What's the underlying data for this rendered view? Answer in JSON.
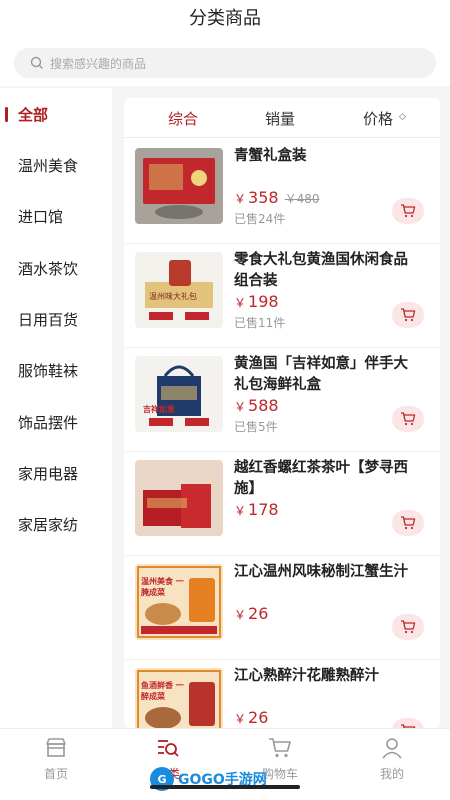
{
  "header": {
    "title": "分类商品"
  },
  "search": {
    "placeholder": "搜索感兴趣的商品"
  },
  "sidebar": {
    "items": [
      {
        "label": "全部",
        "active": true
      },
      {
        "label": "温州美食"
      },
      {
        "label": "进口馆"
      },
      {
        "label": "酒水茶饮"
      },
      {
        "label": "日用百货"
      },
      {
        "label": "服饰鞋袜"
      },
      {
        "label": "饰品摆件"
      },
      {
        "label": "家用电器"
      },
      {
        "label": "家居家纺"
      }
    ]
  },
  "sort": {
    "items": [
      {
        "label": "综合",
        "active": true
      },
      {
        "label": "销量"
      },
      {
        "label": "价格"
      }
    ]
  },
  "currency": "￥",
  "products": [
    {
      "name": "青蟹礼盒装",
      "price": "358",
      "original_price": "￥480",
      "sold": "已售24件"
    },
    {
      "name": "零食大礼包黄渔国休闲食品组合装",
      "price": "198",
      "sold": "已售11件",
      "thumb_text": "温州味大礼包"
    },
    {
      "name": "黄渔国「吉祥如意」伴手大礼包海鲜礼盒",
      "price": "588",
      "sold": "已售5件",
      "thumb_text": "吉祥如意"
    },
    {
      "name": "越红香螺红茶茶叶【梦寻西施】",
      "price": "178",
      "sold": ""
    },
    {
      "name": "江心温州风味秘制江蟹生汁",
      "price": "26",
      "sold": "",
      "thumb_text": "温州美食 一腌成菜"
    },
    {
      "name": "江心熟醉汁花雕熟醉汁",
      "price": "26",
      "sold": "",
      "thumb_text": "鱼酒鲜香 一醉成菜"
    }
  ],
  "tabbar": {
    "items": [
      {
        "label": "首页"
      },
      {
        "label": "分类",
        "active": true
      },
      {
        "label": "购物车"
      },
      {
        "label": "我的"
      }
    ]
  },
  "watermark": {
    "text": "GOGO手游网"
  },
  "colors": {
    "accent": "#b01e23",
    "price": "#c0262a",
    "background": "#f5f5f5"
  }
}
